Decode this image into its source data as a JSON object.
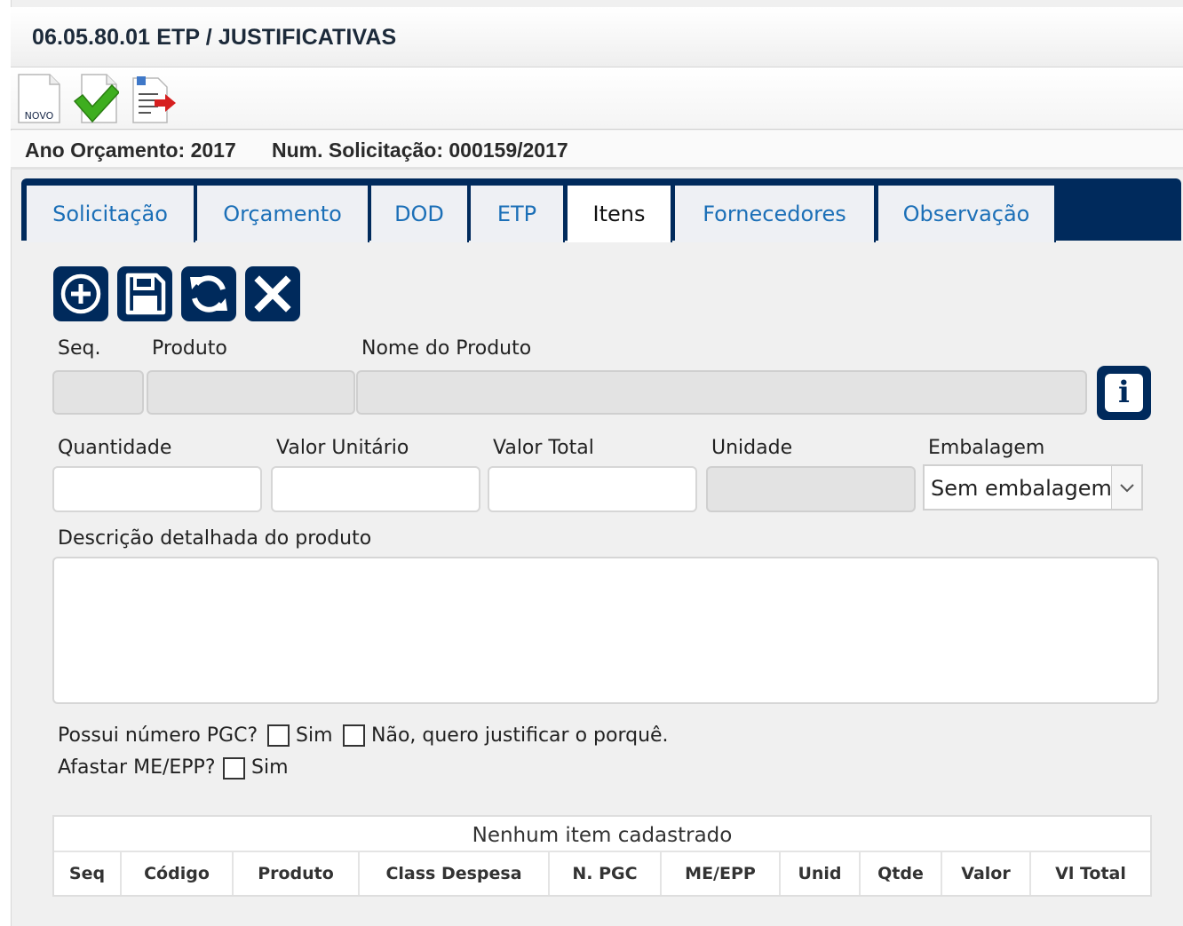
{
  "window": {
    "title": "06.05.80.01 ETP / JUSTIFICATIVAS"
  },
  "toolbar": {
    "new_label": "NOVO",
    "buttons": [
      {
        "name": "novo",
        "icon": "new-document-icon"
      },
      {
        "name": "confirm",
        "icon": "check-document-icon"
      },
      {
        "name": "export",
        "icon": "document-export-icon"
      }
    ]
  },
  "info": {
    "ano_orcamento": "Ano Orçamento: 2017",
    "num_solicitacao": "Num. Solicitação: 000159/2017"
  },
  "tabs": [
    {
      "label": "Solicitação",
      "active": false
    },
    {
      "label": "Orçamento",
      "active": false
    },
    {
      "label": "DOD",
      "active": false
    },
    {
      "label": "ETP",
      "active": false
    },
    {
      "label": "Itens",
      "active": true
    },
    {
      "label": "Fornecedores",
      "active": false
    },
    {
      "label": "Observação",
      "active": false
    }
  ],
  "actions": [
    {
      "name": "add",
      "icon": "plus-circle-icon"
    },
    {
      "name": "save",
      "icon": "floppy-disk-icon"
    },
    {
      "name": "refresh",
      "icon": "refresh-icon"
    },
    {
      "name": "cancel",
      "icon": "close-icon"
    }
  ],
  "form": {
    "seq_label": "Seq.",
    "produto_label": "Produto",
    "nome_produto_label": "Nome do Produto",
    "info_icon": "i",
    "quantidade_label": "Quantidade",
    "valor_unitario_label": "Valor Unitário",
    "valor_total_label": "Valor Total",
    "unidade_label": "Unidade",
    "embalagem_label": "Embalagem",
    "embalagem_value": "Sem embalagem",
    "descricao_label": "Descrição detalhada do produto",
    "pgc_question": "Possui número PGC?",
    "pgc_sim": "Sim",
    "pgc_nao": "Não, quero justificar o porquê.",
    "afastar_question": "Afastar ME/EPP?",
    "afastar_sim": "Sim"
  },
  "grid": {
    "empty_message": "Nenhum item cadastrado",
    "columns": [
      "Seq",
      "Código",
      "Produto",
      "Class Despesa",
      "N. PGC",
      "ME/EPP",
      "Unid",
      "Qtde",
      "Valor",
      "Vl Total"
    ]
  },
  "colors": {
    "primary": "#002a5c",
    "tab_text": "#1b6fb7",
    "panel_bg": "#f0f0f0"
  }
}
